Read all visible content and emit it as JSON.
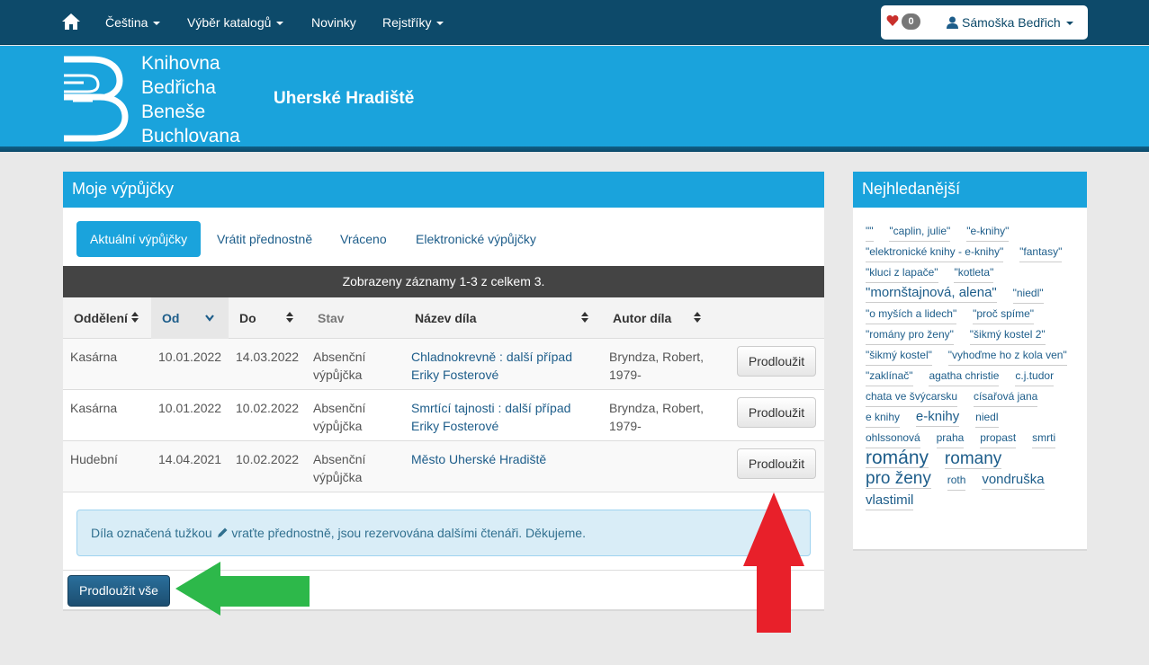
{
  "nav": {
    "items": [
      "Čeština",
      "Výběr katalogů",
      "Novinky",
      "Rejstříky"
    ],
    "favorites_count": "0",
    "user": "Sámoška Bedřich"
  },
  "header": {
    "logo_lines": [
      "Knihovna",
      "Bedřicha",
      "Beneše",
      "Buchlovana"
    ],
    "city": "Uherské Hradiště"
  },
  "main": {
    "title": "Moje výpůjčky",
    "tabs": [
      "Aktuální výpůjčky",
      "Vrátit přednostně",
      "Vráceno",
      "Elektronické výpůjčky"
    ],
    "records_info": "Zobrazeny záznamy 1-3 z celkem 3.",
    "columns": [
      "Oddělení",
      "Od",
      "Do",
      "Stav",
      "Název díla",
      "Autor díla"
    ],
    "rows": [
      {
        "dept": "Kasárna",
        "from": "10.01.2022",
        "to": "14.03.2022",
        "status": "Absenční výpůjčka",
        "title": "Chladnokrevně : další případ Eriky Fosterové",
        "author": "Bryndza, Robert, 1979-",
        "action": "Prodloužit"
      },
      {
        "dept": "Kasárna",
        "from": "10.01.2022",
        "to": "10.02.2022",
        "status": "Absenční výpůjčka",
        "title": "Smrtící tajnosti : další případ Eriky Fosterové",
        "author": "Bryndza, Robert, 1979-",
        "action": "Prodloužit"
      },
      {
        "dept": "Hudební",
        "from": "14.04.2021",
        "to": "10.02.2022",
        "status": "Absenční výpůjčka",
        "title": "Město Uherské Hradiště",
        "author": "",
        "action": "Prodloužit"
      }
    ],
    "info_before": "Díla označená tužkou",
    "info_after": "vraťte přednostně, jsou rezervována dalšími čtenáři. Děkujeme.",
    "renew_all": "Prodloužit vše"
  },
  "sidebar": {
    "title": "Nejhledanější",
    "tags": [
      {
        "text": "\"\"",
        "size": 1
      },
      {
        "text": "\"caplin, julie\"",
        "size": 1
      },
      {
        "text": "\"e-knihy\"",
        "size": 1
      },
      {
        "text": "\"elektronické knihy - e-knihy\"",
        "size": 1
      },
      {
        "text": "\"fantasy\"",
        "size": 1
      },
      {
        "text": "\"kluci z lapače\"",
        "size": 1
      },
      {
        "text": "\"kotleta\"",
        "size": 1
      },
      {
        "text": "\"mornštajnová, alena\"",
        "size": 2
      },
      {
        "text": "\"niedl\"",
        "size": 1
      },
      {
        "text": "\"o myších a lidech\"",
        "size": 1
      },
      {
        "text": "\"proč spíme\"",
        "size": 1
      },
      {
        "text": "\"romány pro ženy\"",
        "size": 1
      },
      {
        "text": "\"šikmý kostel 2\"",
        "size": 1
      },
      {
        "text": "\"šikmý kostel\"",
        "size": 1
      },
      {
        "text": "\"vyhoďme ho z kola ven\"",
        "size": 1
      },
      {
        "text": "\"zaklínač\"",
        "size": 1
      },
      {
        "text": "agatha christie",
        "size": 1
      },
      {
        "text": "c.j.tudor",
        "size": 1
      },
      {
        "text": "chata ve švýcarsku",
        "size": 1
      },
      {
        "text": "císařová jana",
        "size": 1
      },
      {
        "text": "e knihy",
        "size": 1
      },
      {
        "text": "e-knihy",
        "size": 2
      },
      {
        "text": "niedl",
        "size": 1
      },
      {
        "text": "ohlssonová",
        "size": 1
      },
      {
        "text": "praha",
        "size": 1
      },
      {
        "text": "propast",
        "size": 1
      },
      {
        "text": "smrti",
        "size": 1
      },
      {
        "text": "romány",
        "size": 4
      },
      {
        "text": "romany",
        "size": 3
      },
      {
        "text": "pro ženy",
        "size": 3
      },
      {
        "text": "roth",
        "size": 1
      },
      {
        "text": "vondruška",
        "size": 2
      },
      {
        "text": "vlastimil",
        "size": 2
      }
    ]
  },
  "colors": {
    "navbar": "#0d4a6a",
    "accent": "#1aa3dc",
    "link": "#1d5d8a",
    "red_arrow": "#e8202a",
    "green_arrow": "#2db84a"
  },
  "icons": [
    "home-icon",
    "heart-icon",
    "user-icon",
    "pencil-icon",
    "sort-icon"
  ]
}
